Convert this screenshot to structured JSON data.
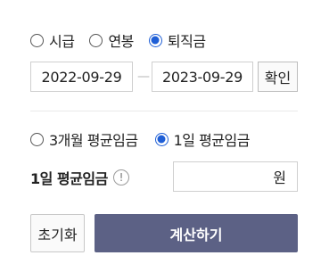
{
  "pay_type": {
    "options": [
      {
        "label": "시급",
        "checked": false
      },
      {
        "label": "연봉",
        "checked": false
      },
      {
        "label": "퇴직금",
        "checked": true
      }
    ]
  },
  "period": {
    "start_date": "2022-09-29",
    "separator": "—",
    "end_date": "2023-09-29",
    "confirm_label": "확인"
  },
  "avg_type": {
    "options": [
      {
        "label": "3개월 평균임금",
        "checked": false
      },
      {
        "label": "1일 평균임금",
        "checked": true
      }
    ]
  },
  "daily_avg": {
    "label": "1일 평균임금",
    "info_glyph": "!",
    "unit": "원"
  },
  "actions": {
    "reset_label": "초기화",
    "calculate_label": "계산하기"
  },
  "colors": {
    "accent": "#1f5fd6",
    "primary_button": "#5c6185"
  }
}
